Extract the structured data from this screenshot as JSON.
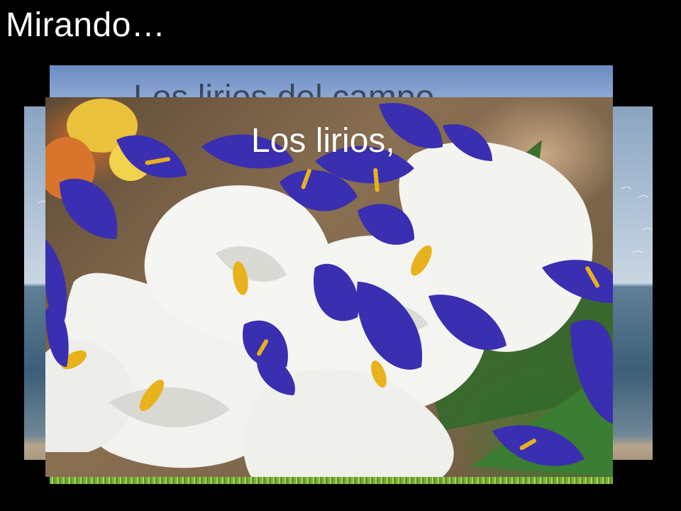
{
  "slide": {
    "title": "Mirando…",
    "mid_caption": "Los lirios del campo",
    "front_caption": "Los lirios,"
  },
  "colors": {
    "background": "#000000",
    "iris": "#3a2fb0",
    "calla": "#f4f4f2",
    "spadix": "#e8b21c"
  }
}
